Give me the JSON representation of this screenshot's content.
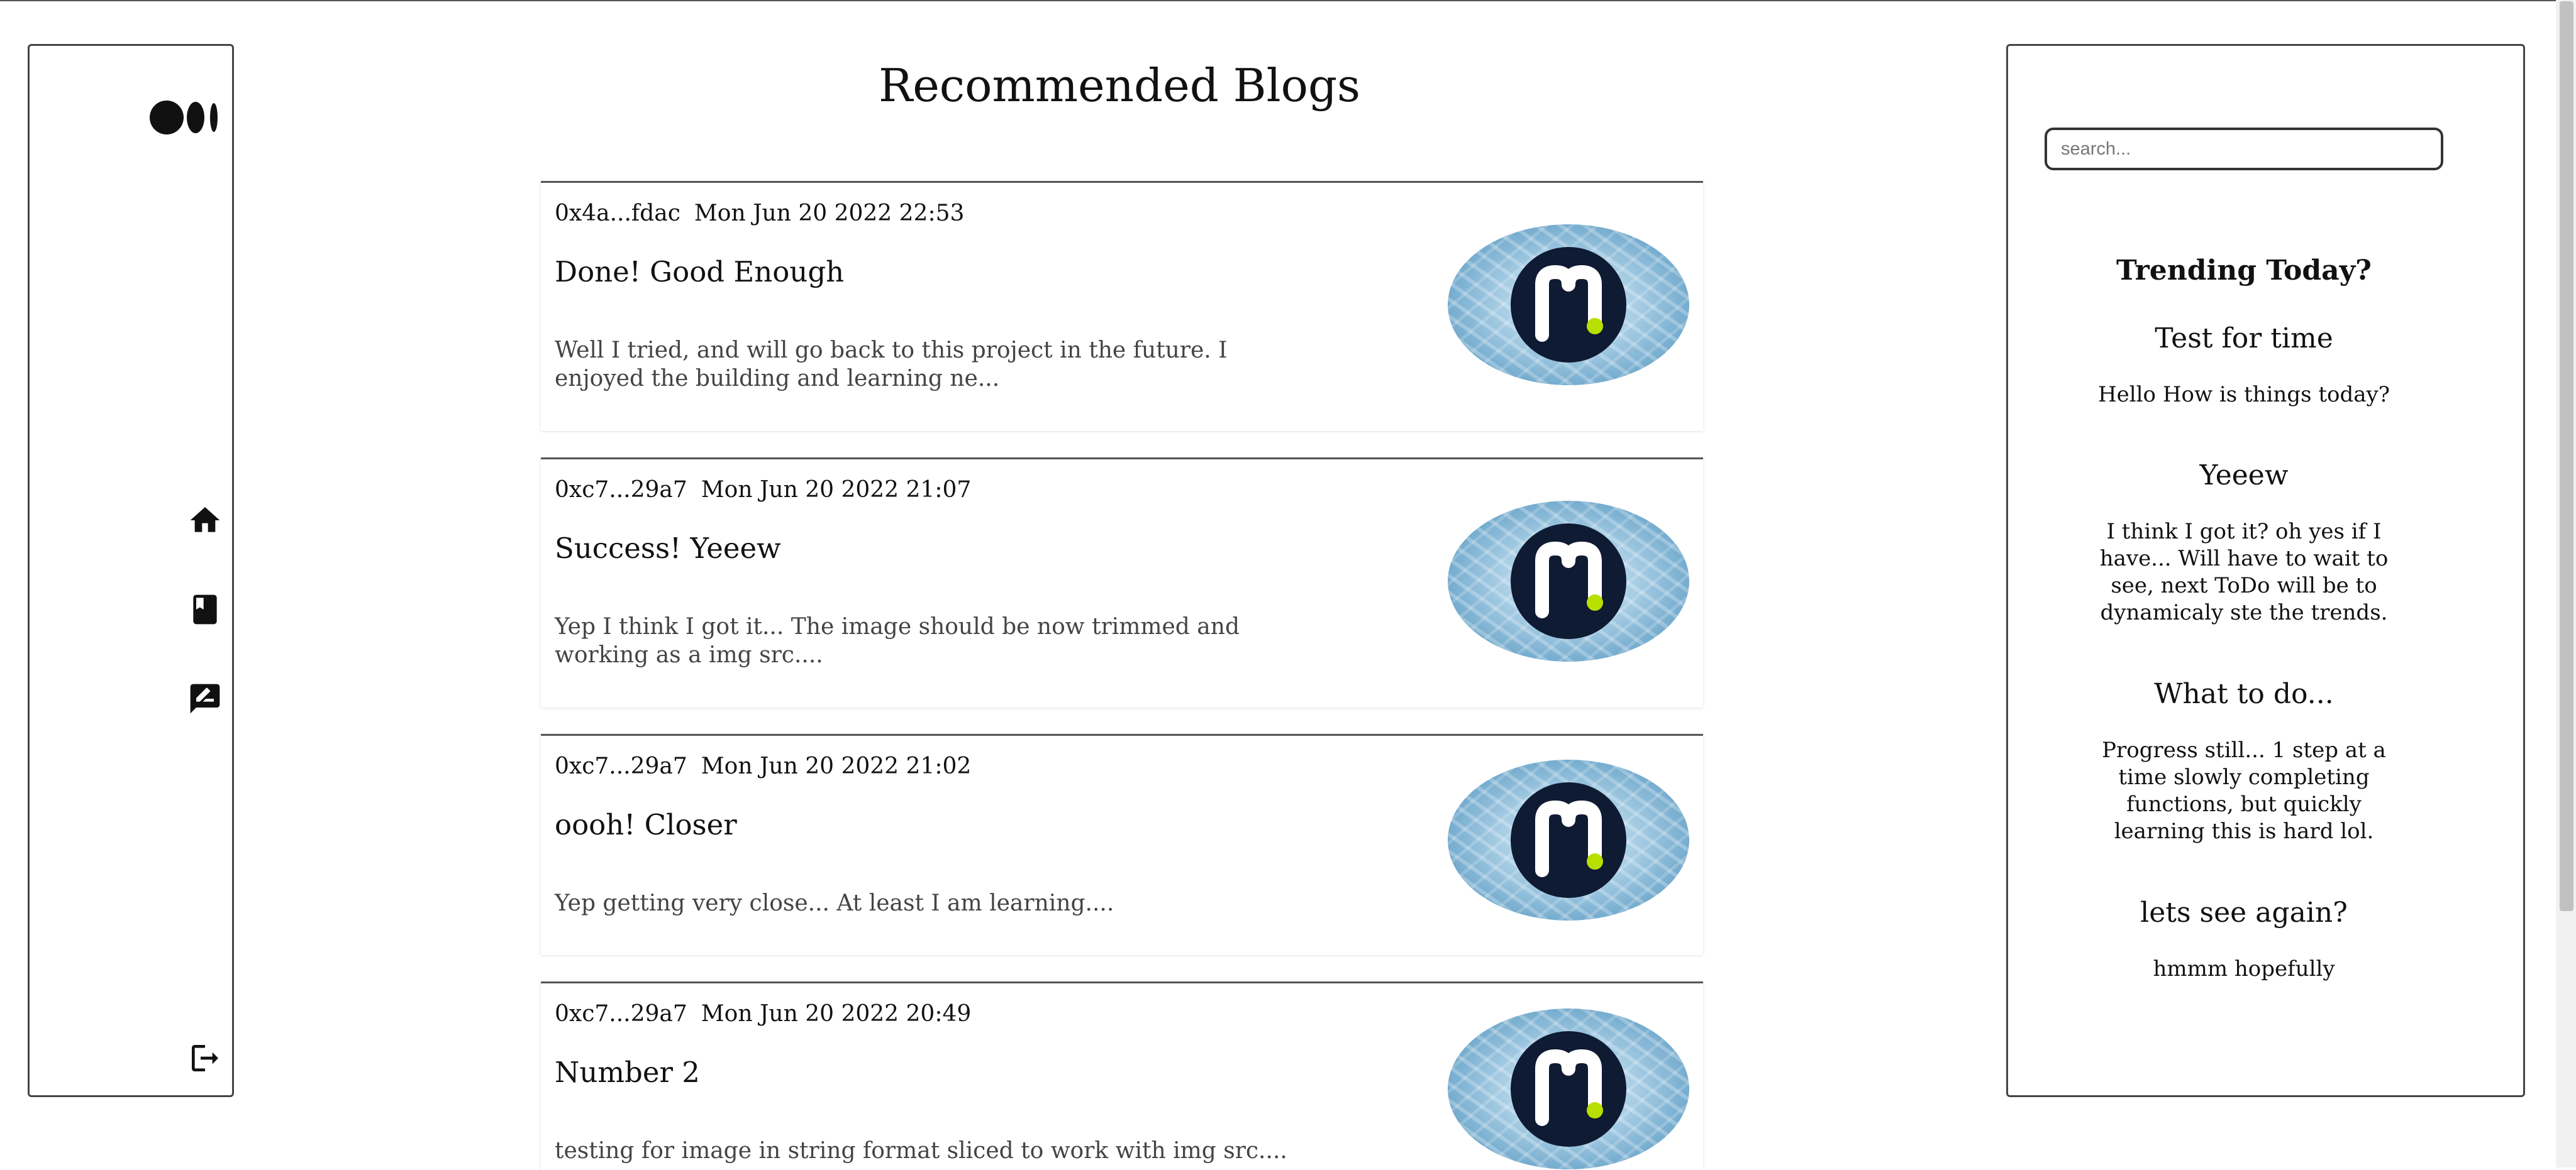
{
  "nav": {
    "logo": "medium-logo",
    "icons": [
      "home-icon",
      "book-icon",
      "write-icon",
      "logout-icon"
    ]
  },
  "page": {
    "title": "Recommended Blogs"
  },
  "posts": [
    {
      "author": "0x4a...fdac",
      "date": "Mon Jun 20 2022 22:53",
      "title": "Done! Good Enough",
      "excerpt": "Well I tried, and will go back to this project in the future. I enjoyed the building and learning ne..."
    },
    {
      "author": "0xc7...29a7",
      "date": "Mon Jun 20 2022 21:07",
      "title": "Success! Yeeew",
      "excerpt": "Yep I think I got it... The image should be now trimmed and working as a img src...."
    },
    {
      "author": "0xc7...29a7",
      "date": "Mon Jun 20 2022 21:02",
      "title": "oooh! Closer",
      "excerpt": "Yep getting very close... At least I am learning...."
    },
    {
      "author": "0xc7...29a7",
      "date": "Mon Jun 20 2022 20:49",
      "title": "Number 2",
      "excerpt": "testing for image in string format sliced to work with img src...."
    }
  ],
  "sidebar": {
    "search_placeholder": "search...",
    "heading": "Trending Today?",
    "trending": [
      {
        "title": "Test for time",
        "body": "Hello How is things today?"
      },
      {
        "title": "Yeeew",
        "body": "I think I got it? oh yes if I have... Will have to wait to see, next ToDo will be to dynamicaly ste the trends."
      },
      {
        "title": "What to do...",
        "body": "Progress still... 1 step at a time slowly completing functions, but quickly learning this is hard lol."
      },
      {
        "title": "lets see again?",
        "body": "hmmm hopefully"
      }
    ]
  },
  "colors": {
    "logo_dark": "#0f1a33",
    "logo_accent": "#b7e000"
  }
}
